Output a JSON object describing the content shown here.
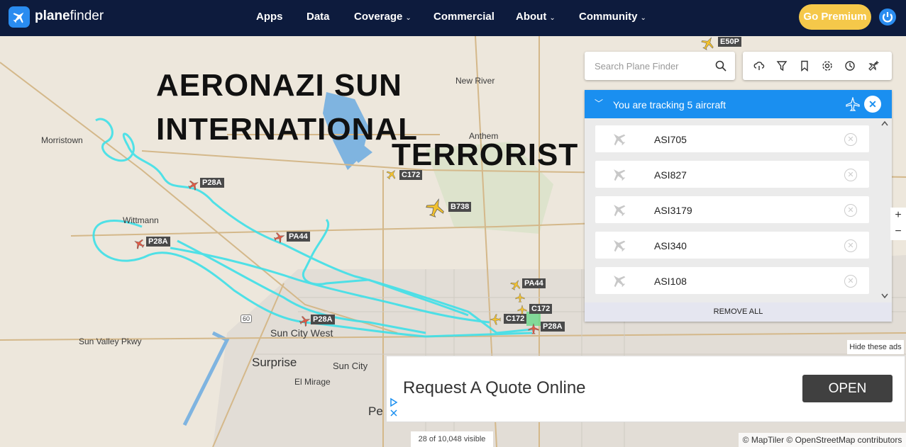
{
  "nav": {
    "brand_prefix": "plane",
    "brand_suffix": "finder",
    "items": [
      {
        "label": "Apps",
        "dropdown": false
      },
      {
        "label": "Data",
        "dropdown": false
      },
      {
        "label": "Coverage",
        "dropdown": true
      },
      {
        "label": "Commercial",
        "dropdown": false
      },
      {
        "label": "About",
        "dropdown": true
      },
      {
        "label": "Community",
        "dropdown": true
      }
    ],
    "premium_label": "Go Premium"
  },
  "search": {
    "placeholder": "Search Plane Finder"
  },
  "toolbar_icons": [
    "cloud-icon",
    "filter-icon",
    "bookmark-icon",
    "settings-icon",
    "history-icon",
    "add-aircraft-icon"
  ],
  "tracking": {
    "title": "You are tracking 5 aircraft",
    "aircraft": [
      "ASI705",
      "ASI827",
      "ASI3179",
      "ASI340",
      "ASI108"
    ],
    "remove_all_label": "REMOVE ALL"
  },
  "overlay": {
    "line1": "AERONAZI SUN",
    "line2": "INTERNATIONAL",
    "line3": "TERRORIST"
  },
  "places": [
    "Morristown",
    "Wittmann",
    "New River",
    "Anthem",
    "Sun City West",
    "Sun Valley Pkwy",
    "Surprise",
    "Sun City",
    "El Mirage",
    "Pe",
    "60"
  ],
  "aircraft_labels": [
    "E50P",
    "C172",
    "B738",
    "P28A",
    "P28A",
    "PA44",
    "PA44",
    "C172",
    "C172",
    "P28A",
    "P28A"
  ],
  "zoom": {
    "in": "+",
    "out": "−"
  },
  "ad": {
    "text": "Request A Quote Online",
    "button": "OPEN",
    "hide_label": "Hide these ads"
  },
  "status": {
    "visible_count": "28 of 10,048 visible",
    "attribution": "© MapTiler © OpenStreetMap contributors"
  },
  "colors": {
    "nav_bg": "#0d1b3d",
    "accent": "#1a8ff0",
    "premium": "#f5c84a",
    "track_line": "#3ee0e8"
  }
}
